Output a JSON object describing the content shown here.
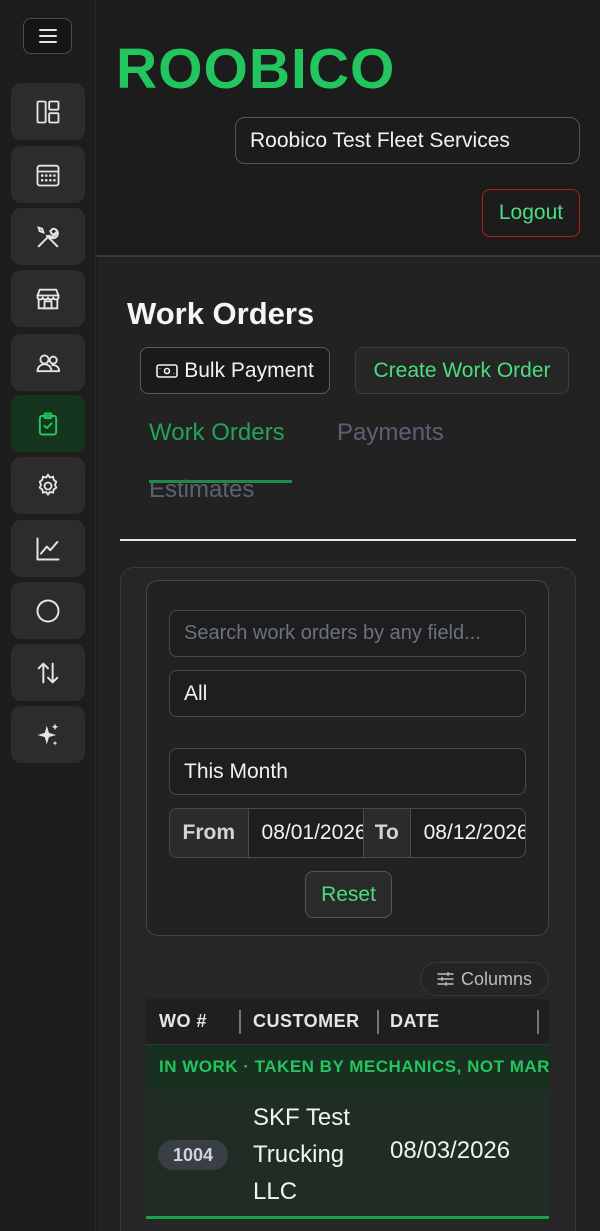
{
  "brand": {
    "name": "ROOBICO"
  },
  "header": {
    "organization": "Roobico Test Fleet Services",
    "logout_label": "Logout"
  },
  "sidebar": {
    "items": [
      {
        "id": "dashboard",
        "icon": "layout-icon",
        "active": false
      },
      {
        "id": "calendar",
        "icon": "calendar-icon",
        "active": false
      },
      {
        "id": "tools",
        "icon": "wrench-screwdriver-icon",
        "active": false
      },
      {
        "id": "store",
        "icon": "storefront-icon",
        "active": false
      },
      {
        "id": "customers",
        "icon": "users-icon",
        "active": false
      },
      {
        "id": "work-orders",
        "icon": "clipboard-check-icon",
        "active": true
      },
      {
        "id": "settings",
        "icon": "gear-icon",
        "active": false
      },
      {
        "id": "reports",
        "icon": "line-chart-icon",
        "active": false
      },
      {
        "id": "circle",
        "icon": "circle-icon",
        "active": false
      },
      {
        "id": "transfers",
        "icon": "arrows-up-down-icon",
        "active": false
      },
      {
        "id": "ai",
        "icon": "sparkles-icon",
        "active": false
      }
    ],
    "accent": "#22c55e"
  },
  "page": {
    "title": "Work Orders",
    "bulk_payment_label": "Bulk Payment",
    "create_label": "Create Work Order"
  },
  "tabs": [
    {
      "label": "Work Orders",
      "active": true
    },
    {
      "label": "Payments",
      "active": false
    },
    {
      "label": "Estimates",
      "active": false
    }
  ],
  "filters": {
    "search_placeholder": "Search work orders by any field...",
    "search_value": "",
    "status_value": "All",
    "period_value": "This Month",
    "from_label": "From",
    "from_value": "08/01/2026",
    "to_label": "To",
    "to_value": "08/12/2026",
    "reset_label": "Reset"
  },
  "table": {
    "columns_button_label": "Columns",
    "headers": [
      "WO #",
      "CUSTOMER",
      "DATE"
    ],
    "group_label": "IN WORK · TAKEN BY MECHANICS, NOT MARKED DONE",
    "rows": [
      {
        "wo": "1004",
        "customer": "SKF Test Trucking LLC",
        "date": "08/03/2026"
      }
    ]
  },
  "colors": {
    "brand": "#22c55e",
    "background": "#1c1c1c",
    "danger_border": "#b91c1c",
    "active_tab": "#22a35a"
  }
}
